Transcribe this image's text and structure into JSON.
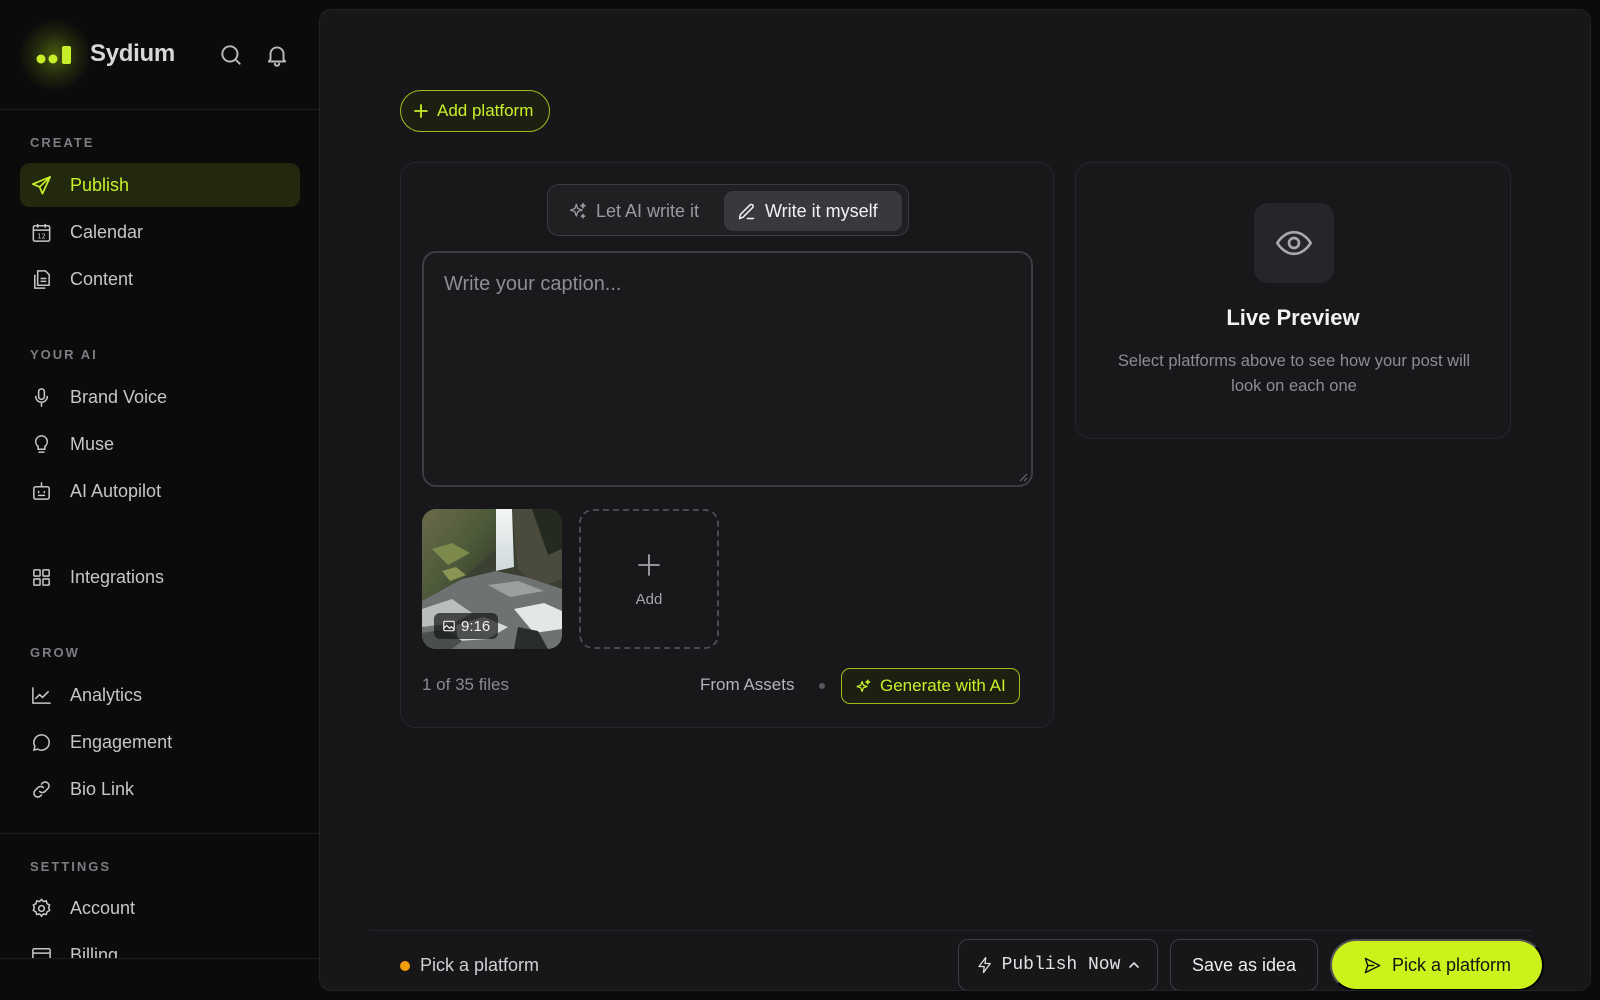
{
  "app": {
    "name": "Sydium",
    "accent_color": "#c8f02a"
  },
  "header": {
    "icons": [
      "search-icon",
      "bell-icon"
    ]
  },
  "sidebar": {
    "sections": [
      {
        "label": "CREATE",
        "items": [
          {
            "label": "Publish",
            "icon": "send-icon",
            "active": true
          },
          {
            "label": "Calendar",
            "icon": "calendar-icon"
          },
          {
            "label": "Content",
            "icon": "documents-icon"
          }
        ]
      },
      {
        "label": "YOUR AI",
        "items": [
          {
            "label": "Brand Voice",
            "icon": "microphone-icon"
          },
          {
            "label": "Muse",
            "icon": "lightbulb-icon"
          },
          {
            "label": "AI Autopilot",
            "icon": "robot-icon"
          },
          {
            "label": "Integrations",
            "icon": "grid-icon"
          }
        ]
      },
      {
        "label": "GROW",
        "items": [
          {
            "label": "Analytics",
            "icon": "chart-icon"
          },
          {
            "label": "Engagement",
            "icon": "chat-bubble-icon"
          },
          {
            "label": "Bio Link",
            "icon": "link-icon"
          }
        ]
      },
      {
        "label": "SETTINGS",
        "items": [
          {
            "label": "Account",
            "icon": "gear-icon"
          },
          {
            "label": "Billing",
            "icon": "card-icon"
          }
        ]
      }
    ]
  },
  "main": {
    "add_platform_label": "Add platform",
    "composer": {
      "modes": [
        {
          "label": "Let AI write it",
          "selected": false
        },
        {
          "label": "Write it myself",
          "selected": true
        }
      ],
      "caption": {
        "value": "",
        "placeholder": "Write your caption..."
      },
      "media": [
        {
          "ratio": "9:16",
          "type": "image"
        }
      ],
      "add_tile_label": "Add",
      "file_count": "1 of 35 files",
      "from_assets_label": "From Assets",
      "generate_label": "Generate with AI"
    },
    "preview": {
      "title": "Live Preview",
      "description": "Select platforms above to see how your post will look on each one"
    }
  },
  "footer": {
    "status_text": "Pick a platform",
    "status_color": "#f59e0b",
    "publish_now_label": "Publish Now",
    "save_idea_label": "Save as idea",
    "pick_platform_label": "Pick a platform"
  }
}
